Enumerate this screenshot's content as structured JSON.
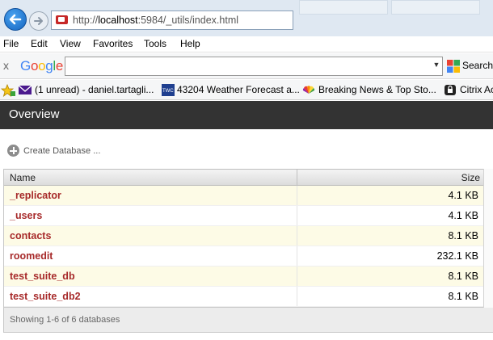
{
  "browser": {
    "url_prefix": "http://",
    "url_host": "localhost",
    "url_rest": ":5984/_utils/index.html",
    "menu": [
      "File",
      "Edit",
      "View",
      "Favorites",
      "Tools",
      "Help"
    ],
    "toolbar": {
      "close_glyph": "x",
      "search_value": "",
      "search_label": "Search"
    },
    "favorites": [
      {
        "icon": "mail-icon",
        "label": "(1 unread) - daniel.tartagli..."
      },
      {
        "icon": "twc-icon",
        "icon_text": "TWC",
        "label": "43204 Weather Forecast a..."
      },
      {
        "icon": "nbc-icon",
        "label": "Breaking News & Top Sto..."
      },
      {
        "icon": "citrix-icon",
        "label": "Citrix Ac"
      }
    ]
  },
  "page": {
    "title": "Overview",
    "create_label": "Create Database ...",
    "table": {
      "headers": {
        "name": "Name",
        "size": "Size"
      },
      "rows": [
        {
          "name": "_replicator",
          "size": "4.1 KB"
        },
        {
          "name": "_users",
          "size": "4.1 KB"
        },
        {
          "name": "contacts",
          "size": "8.1 KB"
        },
        {
          "name": "roomedit",
          "size": "232.1 KB"
        },
        {
          "name": "test_suite_db",
          "size": "8.1 KB"
        },
        {
          "name": "test_suite_db2",
          "size": "8.1 KB"
        }
      ],
      "footer": "Showing 1-6 of 6 databases"
    }
  },
  "colors": {
    "header_bg": "#333333",
    "db_link": "#a72a2a",
    "row_highlight": "#fdfbe6"
  }
}
